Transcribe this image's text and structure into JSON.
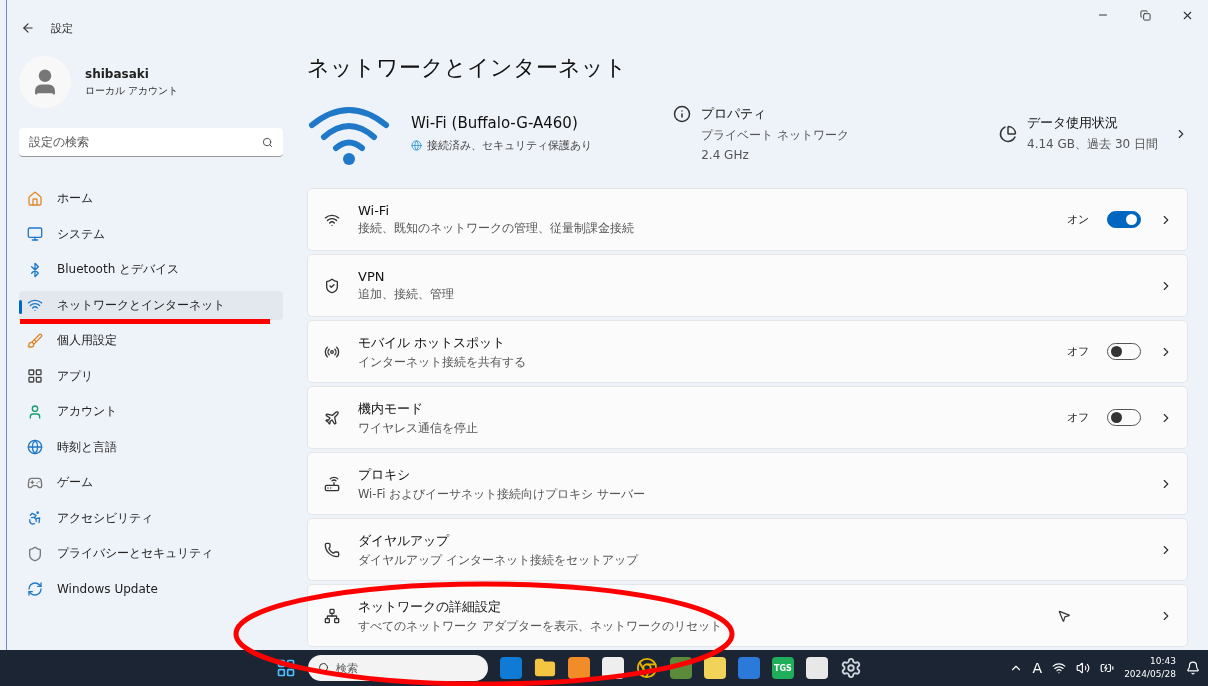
{
  "window": {
    "title": "設定"
  },
  "user": {
    "name": "shibasaki",
    "account": "ローカル アカウント"
  },
  "search": {
    "placeholder": "設定の検索"
  },
  "nav": [
    {
      "label": "ホーム",
      "selected": false
    },
    {
      "label": "システム",
      "selected": false
    },
    {
      "label": "Bluetooth とデバイス",
      "selected": false
    },
    {
      "label": "ネットワークとインターネット",
      "selected": true
    },
    {
      "label": "個人用設定",
      "selected": false
    },
    {
      "label": "アプリ",
      "selected": false
    },
    {
      "label": "アカウント",
      "selected": false
    },
    {
      "label": "時刻と言語",
      "selected": false
    },
    {
      "label": "ゲーム",
      "selected": false
    },
    {
      "label": "アクセシビリティ",
      "selected": false
    },
    {
      "label": "プライバシーとセキュリティ",
      "selected": false
    },
    {
      "label": "Windows Update",
      "selected": false
    }
  ],
  "page_title": "ネットワークとインターネット",
  "connection": {
    "name": "Wi-Fi (Buffalo-G-A460)",
    "status": "接続済み、セキュリティ保護あり"
  },
  "properties": {
    "title": "プロパティ",
    "lines": [
      "プライベート ネットワーク",
      "2.4 GHz"
    ]
  },
  "usage": {
    "title": "データ使用状況",
    "detail": "4.14 GB、過去 30 日間"
  },
  "settings": [
    {
      "kind": "toggle",
      "title": "Wi-Fi",
      "subtitle": "接続、既知のネットワークの管理、従量制課金接続",
      "state_label": "オン",
      "on": true
    },
    {
      "kind": "link",
      "title": "VPN",
      "subtitle": "追加、接続、管理"
    },
    {
      "kind": "toggle",
      "title": "モバイル ホットスポット",
      "subtitle": "インターネット接続を共有する",
      "state_label": "オフ",
      "on": false
    },
    {
      "kind": "toggle",
      "title": "機内モード",
      "subtitle": "ワイヤレス通信を停止",
      "state_label": "オフ",
      "on": false
    },
    {
      "kind": "link",
      "title": "プロキシ",
      "subtitle": "Wi-Fi およびイーサネット接続向けプロキシ サーバー"
    },
    {
      "kind": "link",
      "title": "ダイヤルアップ",
      "subtitle": "ダイヤルアップ インターネット接続をセットアップ"
    },
    {
      "kind": "link",
      "title": "ネットワークの詳細設定",
      "subtitle": "すべてのネットワーク アダプターを表示、ネットワークのリセット"
    }
  ],
  "taskbar": {
    "search_placeholder": "検索",
    "app_badge": "TGS",
    "ime": "A",
    "time": "10:43",
    "date": "2024/05/28"
  }
}
